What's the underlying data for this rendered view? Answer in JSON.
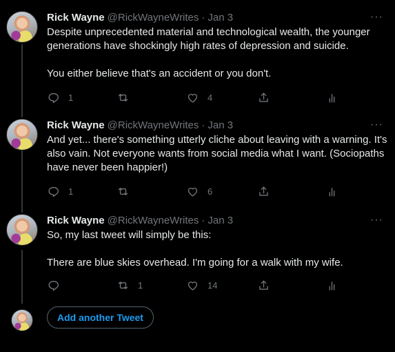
{
  "tweets": [
    {
      "name": "Rick Wayne",
      "handle": "@RickWayneWrites",
      "separator": "·",
      "date": "Jan 3",
      "more": "···",
      "text": "Despite unprecedented material and technological wealth, the younger generations have shockingly high rates of depression and suicide.\n\nYou either believe that's an accident or you don't.",
      "replies": "1",
      "retweets": "",
      "likes": "4"
    },
    {
      "name": "Rick Wayne",
      "handle": "@RickWayneWrites",
      "separator": "·",
      "date": "Jan 3",
      "more": "···",
      "text": "And yet... there's something utterly cliche about leaving with a warning. It's also vain. Not everyone wants from social media what I want. (Sociopaths have never been happier!)",
      "replies": "1",
      "retweets": "",
      "likes": "6"
    },
    {
      "name": "Rick Wayne",
      "handle": "@RickWayneWrites",
      "separator": "·",
      "date": "Jan 3",
      "more": "···",
      "text": "So, my last tweet will simply be this:\n\nThere are blue skies overhead. I'm going for a walk with my wife.",
      "replies": "",
      "retweets": "1",
      "likes": "14"
    }
  ],
  "compose": {
    "add_label": "Add another Tweet"
  },
  "icons": {
    "reply": "reply-icon",
    "retweet": "retweet-icon",
    "like": "heart-icon",
    "share": "share-icon",
    "analytics": "analytics-icon",
    "more": "more-icon"
  },
  "colors": {
    "background": "#000000",
    "text": "#e7e9ea",
    "secondary": "#71767b",
    "accent": "#1d9bf0"
  }
}
